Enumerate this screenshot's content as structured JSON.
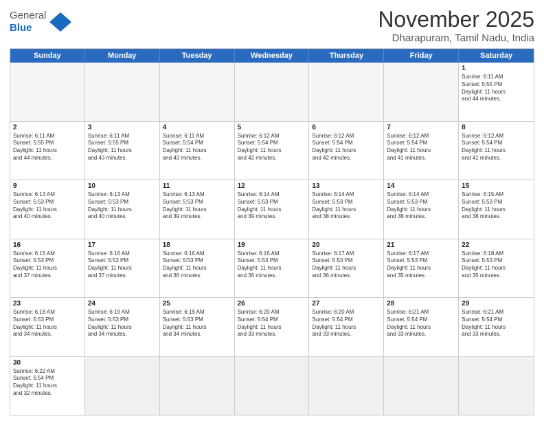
{
  "header": {
    "logo_general": "General",
    "logo_blue": "Blue",
    "month_title": "November 2025",
    "location": "Dharapuram, Tamil Nadu, India"
  },
  "weekdays": [
    "Sunday",
    "Monday",
    "Tuesday",
    "Wednesday",
    "Thursday",
    "Friday",
    "Saturday"
  ],
  "weeks": [
    [
      {
        "day": "",
        "info": ""
      },
      {
        "day": "",
        "info": ""
      },
      {
        "day": "",
        "info": ""
      },
      {
        "day": "",
        "info": ""
      },
      {
        "day": "",
        "info": ""
      },
      {
        "day": "",
        "info": ""
      },
      {
        "day": "1",
        "info": "Sunrise: 6:11 AM\nSunset: 5:55 PM\nDaylight: 11 hours\nand 44 minutes."
      }
    ],
    [
      {
        "day": "2",
        "info": "Sunrise: 6:11 AM\nSunset: 5:55 PM\nDaylight: 11 hours\nand 44 minutes."
      },
      {
        "day": "3",
        "info": "Sunrise: 6:11 AM\nSunset: 5:55 PM\nDaylight: 11 hours\nand 43 minutes."
      },
      {
        "day": "4",
        "info": "Sunrise: 6:11 AM\nSunset: 5:54 PM\nDaylight: 11 hours\nand 43 minutes."
      },
      {
        "day": "5",
        "info": "Sunrise: 6:12 AM\nSunset: 5:54 PM\nDaylight: 11 hours\nand 42 minutes."
      },
      {
        "day": "6",
        "info": "Sunrise: 6:12 AM\nSunset: 5:54 PM\nDaylight: 11 hours\nand 42 minutes."
      },
      {
        "day": "7",
        "info": "Sunrise: 6:12 AM\nSunset: 5:54 PM\nDaylight: 11 hours\nand 41 minutes."
      },
      {
        "day": "8",
        "info": "Sunrise: 6:12 AM\nSunset: 5:54 PM\nDaylight: 11 hours\nand 41 minutes."
      }
    ],
    [
      {
        "day": "9",
        "info": "Sunrise: 6:13 AM\nSunset: 5:53 PM\nDaylight: 11 hours\nand 40 minutes."
      },
      {
        "day": "10",
        "info": "Sunrise: 6:13 AM\nSunset: 5:53 PM\nDaylight: 11 hours\nand 40 minutes."
      },
      {
        "day": "11",
        "info": "Sunrise: 6:13 AM\nSunset: 5:53 PM\nDaylight: 11 hours\nand 39 minutes."
      },
      {
        "day": "12",
        "info": "Sunrise: 6:14 AM\nSunset: 5:53 PM\nDaylight: 11 hours\nand 39 minutes."
      },
      {
        "day": "13",
        "info": "Sunrise: 6:14 AM\nSunset: 5:53 PM\nDaylight: 11 hours\nand 38 minutes."
      },
      {
        "day": "14",
        "info": "Sunrise: 6:14 AM\nSunset: 5:53 PM\nDaylight: 11 hours\nand 38 minutes."
      },
      {
        "day": "15",
        "info": "Sunrise: 6:15 AM\nSunset: 5:53 PM\nDaylight: 11 hours\nand 38 minutes."
      }
    ],
    [
      {
        "day": "16",
        "info": "Sunrise: 6:15 AM\nSunset: 5:53 PM\nDaylight: 11 hours\nand 37 minutes."
      },
      {
        "day": "17",
        "info": "Sunrise: 6:16 AM\nSunset: 5:53 PM\nDaylight: 11 hours\nand 37 minutes."
      },
      {
        "day": "18",
        "info": "Sunrise: 6:16 AM\nSunset: 5:53 PM\nDaylight: 11 hours\nand 36 minutes."
      },
      {
        "day": "19",
        "info": "Sunrise: 6:16 AM\nSunset: 5:53 PM\nDaylight: 11 hours\nand 36 minutes."
      },
      {
        "day": "20",
        "info": "Sunrise: 6:17 AM\nSunset: 5:53 PM\nDaylight: 11 hours\nand 36 minutes."
      },
      {
        "day": "21",
        "info": "Sunrise: 6:17 AM\nSunset: 5:53 PM\nDaylight: 11 hours\nand 35 minutes."
      },
      {
        "day": "22",
        "info": "Sunrise: 6:18 AM\nSunset: 5:53 PM\nDaylight: 11 hours\nand 35 minutes."
      }
    ],
    [
      {
        "day": "23",
        "info": "Sunrise: 6:18 AM\nSunset: 5:53 PM\nDaylight: 11 hours\nand 34 minutes."
      },
      {
        "day": "24",
        "info": "Sunrise: 6:19 AM\nSunset: 5:53 PM\nDaylight: 11 hours\nand 34 minutes."
      },
      {
        "day": "25",
        "info": "Sunrise: 6:19 AM\nSunset: 5:53 PM\nDaylight: 11 hours\nand 34 minutes."
      },
      {
        "day": "26",
        "info": "Sunrise: 6:20 AM\nSunset: 5:54 PM\nDaylight: 11 hours\nand 33 minutes."
      },
      {
        "day": "27",
        "info": "Sunrise: 6:20 AM\nSunset: 5:54 PM\nDaylight: 11 hours\nand 33 minutes."
      },
      {
        "day": "28",
        "info": "Sunrise: 6:21 AM\nSunset: 5:54 PM\nDaylight: 11 hours\nand 33 minutes."
      },
      {
        "day": "29",
        "info": "Sunrise: 6:21 AM\nSunset: 5:54 PM\nDaylight: 11 hours\nand 33 minutes."
      }
    ],
    [
      {
        "day": "30",
        "info": "Sunrise: 6:22 AM\nSunset: 5:54 PM\nDaylight: 11 hours\nand 32 minutes."
      },
      {
        "day": "",
        "info": ""
      },
      {
        "day": "",
        "info": ""
      },
      {
        "day": "",
        "info": ""
      },
      {
        "day": "",
        "info": ""
      },
      {
        "day": "",
        "info": ""
      },
      {
        "day": "",
        "info": ""
      }
    ]
  ]
}
